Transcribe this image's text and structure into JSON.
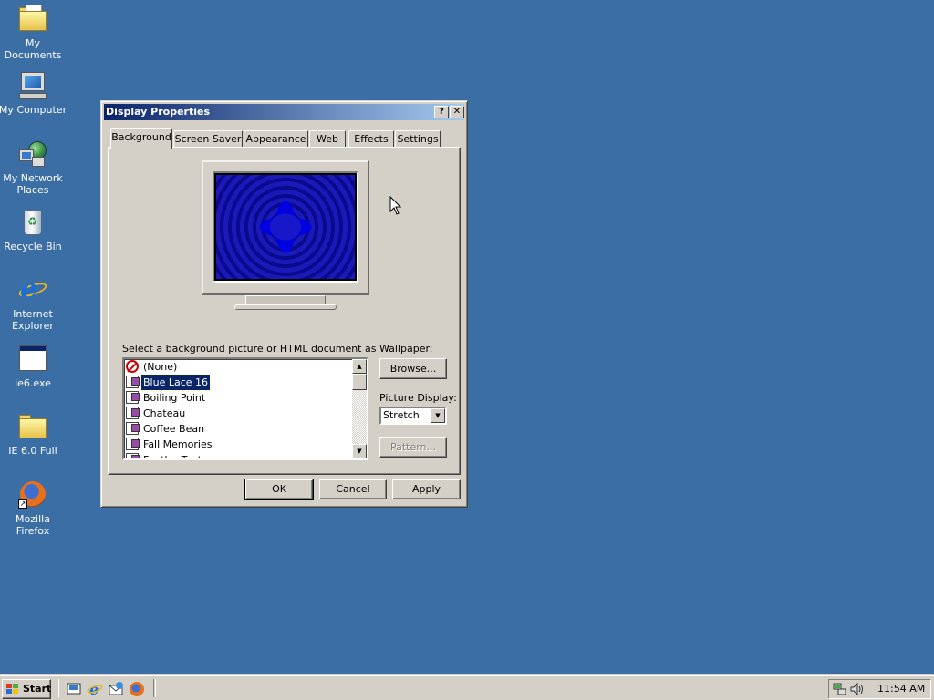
{
  "desktop": {
    "icons": [
      {
        "label": "My Documents",
        "icon": "my-documents-icon"
      },
      {
        "label": "My Computer",
        "icon": "my-computer-icon"
      },
      {
        "label_line1": "My Network",
        "label_line2": "Places",
        "icon": "network-places-icon"
      },
      {
        "label": "Recycle Bin",
        "icon": "recycle-bin-icon"
      },
      {
        "label_line1": "Internet",
        "label_line2": "Explorer",
        "icon": "internet-explorer-icon"
      },
      {
        "label": "ie6.exe",
        "icon": "application-exe-icon"
      },
      {
        "label": "IE 6.0 Full",
        "icon": "folder-icon"
      },
      {
        "label": "Mozilla Firefox",
        "icon": "firefox-icon"
      }
    ]
  },
  "dialog": {
    "title": "Display Properties",
    "help_button": "?",
    "close_button": "✕",
    "tabs": [
      {
        "label": "Background",
        "active": true
      },
      {
        "label": "Screen Saver",
        "active": false
      },
      {
        "label": "Appearance",
        "active": false
      },
      {
        "label": "Web",
        "active": false
      },
      {
        "label": "Effects",
        "active": false
      },
      {
        "label": "Settings",
        "active": false
      }
    ],
    "wallpaper_prompt": "Select a background picture or HTML document as Wallpaper:",
    "wallpapers": [
      {
        "label": "(None)",
        "icon": "none-icon"
      },
      {
        "label": "Blue Lace 16",
        "icon": "bitmap-icon",
        "selected": true
      },
      {
        "label": "Boiling Point",
        "icon": "bitmap-icon"
      },
      {
        "label": "Chateau",
        "icon": "bitmap-icon"
      },
      {
        "label": "Coffee Bean",
        "icon": "bitmap-icon"
      },
      {
        "label": "Fall Memories",
        "icon": "bitmap-icon"
      },
      {
        "label": "FeatherTexture",
        "icon": "bitmap-icon"
      }
    ],
    "browse_label": "Browse...",
    "picture_display_label": "Picture Display:",
    "picture_display_value": "Stretch",
    "pattern_label": "Pattern...",
    "ok_label": "OK",
    "cancel_label": "Cancel",
    "apply_label": "Apply"
  },
  "taskbar": {
    "start_label": "Start",
    "clock": "11:54 AM",
    "quick_launch": [
      "show-desktop-icon",
      "internet-explorer-icon",
      "outlook-express-icon",
      "firefox-icon"
    ],
    "tray": [
      "network-icon",
      "volume-icon"
    ]
  },
  "colors": {
    "desktop": "#3a6ea5",
    "title_start": "#0a246a",
    "title_end": "#a6caf0",
    "face": "#d4d0c8",
    "selection": "#0a246a"
  }
}
